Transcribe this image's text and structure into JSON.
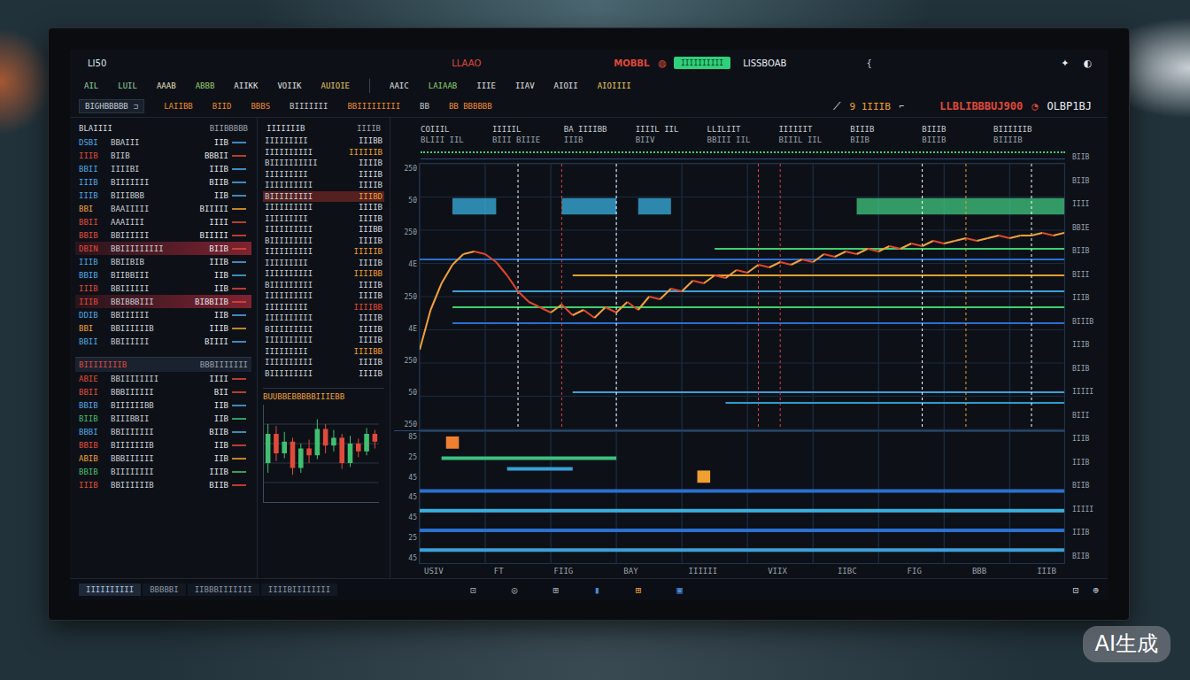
{
  "header": {
    "logo": "LI50",
    "title": "LLAAO",
    "mode": "MOBBL",
    "mode_icon": "◍",
    "action": "IIIIIIIIII",
    "account": "LISSBOAB",
    "extra": "{",
    "icons": [
      "✦",
      "◐"
    ]
  },
  "menu": {
    "left": [
      {
        "label": "AIL",
        "color": "#8fd0a0"
      },
      {
        "label": "LUIL",
        "color": "#8fd0a0"
      },
      {
        "label": "AAAB",
        "color": "#e6e0c0"
      },
      {
        "label": "ABBB",
        "color": "#9ad070"
      },
      {
        "label": "AIIKK",
        "color": "#e0e0e0"
      },
      {
        "label": "VOIIK",
        "color": "#e0e0e0"
      },
      {
        "label": "AUIOIE",
        "color": "#e8c860"
      }
    ],
    "right": [
      {
        "label": "AAIC",
        "color": "#e0e0e0"
      },
      {
        "label": "LAIAAB",
        "color": "#8fd070"
      },
      {
        "label": "IIIE",
        "color": "#e0e0e0"
      },
      {
        "label": "IIAV",
        "color": "#e0e0e0"
      },
      {
        "label": "AIOII",
        "color": "#e0e0e0"
      },
      {
        "label": "AIOIIII",
        "color": "#e8c860"
      }
    ]
  },
  "subbar": {
    "box": {
      "label": "BIGHBBBBB",
      "icon": "⊐"
    },
    "items": [
      {
        "label": "LAIIBB",
        "color": "#f08a30"
      },
      {
        "label": "BIID",
        "color": "#f08a30"
      },
      {
        "label": "BBBS",
        "color": "#f08a30"
      },
      {
        "label": "BIIIIIII",
        "color": "#c8c8d0"
      },
      {
        "label": "BBIIIIIIIII",
        "color": "#f08a30"
      },
      {
        "label": "BB",
        "color": "#c8c8d0"
      },
      {
        "label": "BB BBBBBB",
        "color": "#f08a30"
      }
    ],
    "quote": {
      "trend_icon": "⟋",
      "value": "9 1IIIB",
      "mark": "⌐",
      "price": "LLBLIBBBUJ900",
      "alert_icon": "◔",
      "symbol": "OLBP1BJ"
    }
  },
  "watchlist": {
    "title": "BLAIIII",
    "tag": "BIIBBBBB",
    "rows": [
      {
        "code": "DSBI",
        "name": "BBAIII",
        "value": "IIB",
        "color": "#4aa8e8",
        "flagged": false
      },
      {
        "code": "IIIB",
        "name": "BIIB",
        "value": "BBBII",
        "color": "#e04a3a",
        "flagged": false
      },
      {
        "code": "BBII",
        "name": "IIIIBI",
        "value": "IIIB",
        "color": "#4aa8e8",
        "flagged": false
      },
      {
        "code": "IIIB",
        "name": "BIIIIIII",
        "value": "BIIB",
        "color": "#4aa8e8",
        "flagged": false
      },
      {
        "code": "IIIB",
        "name": "BIIIBBB",
        "value": "IIB",
        "color": "#4aa8e8",
        "flagged": false
      },
      {
        "code": "BBI",
        "name": "BAAIIIII",
        "value": "BIIIII",
        "color": "#f0a030",
        "flagged": false
      },
      {
        "code": "BBII",
        "name": "AAAIIII",
        "value": "IIII",
        "color": "#e04a3a",
        "flagged": false
      },
      {
        "code": "BBIB",
        "name": "BBIIIIII",
        "value": "BIIIII",
        "color": "#e04a3a",
        "flagged": false
      },
      {
        "code": "DBIN",
        "name": "BBIIIIIIIII",
        "value": "BIIB",
        "color": "#e04a3a",
        "flagged": true
      },
      {
        "code": "IIIB",
        "name": "BBIIBIB",
        "value": "IIIB",
        "color": "#4aa8e8",
        "flagged": false
      },
      {
        "code": "BBIB",
        "name": "BIIBBIII",
        "value": "IIB",
        "color": "#4aa8e8",
        "flagged": false
      },
      {
        "code": "IIIB",
        "name": "BBIIIIII",
        "value": "IIB",
        "color": "#e04a3a",
        "flagged": false
      },
      {
        "code": "IIIB",
        "name": "BBIBBBIII",
        "value": "BIBBIIB",
        "color": "#e04a3a",
        "flagged": true
      },
      {
        "code": "DDIB",
        "name": "BBIIIIII",
        "value": "IIB",
        "color": "#4aa8e8",
        "flagged": false
      },
      {
        "code": "BBI",
        "name": "BBIIIIIIB",
        "value": "IIIB",
        "color": "#f0a030",
        "flagged": false
      },
      {
        "code": "BBII",
        "name": "BBIIIIII",
        "value": "BIIII",
        "color": "#4aa8e8",
        "flagged": false
      }
    ]
  },
  "positions": {
    "title": "BIIIIIIIIB",
    "tag": "BBBIIIIIII",
    "rows": [
      {
        "code": "ABIE",
        "name": "BBIIIIIIII",
        "value": "IIII",
        "color": "#e04a3a",
        "flagged": false
      },
      {
        "code": "BBII",
        "name": "BBBIIIIII",
        "value": "BII",
        "color": "#e04a3a",
        "flagged": false
      },
      {
        "code": "BBIB",
        "name": "BIIIIIIBB",
        "value": "IIB",
        "color": "#4aa8e8",
        "flagged": false
      },
      {
        "code": "BIIB",
        "name": "BIIIBBII",
        "value": "IIB",
        "color": "#40c070",
        "flagged": false
      },
      {
        "code": "BBBI",
        "name": "BBIIIIIII",
        "value": "BIIB",
        "color": "#4aa8e8",
        "flagged": false
      },
      {
        "code": "BBIB",
        "name": "BIIIIIIIB",
        "value": "IIB",
        "color": "#e04a3a",
        "flagged": false
      },
      {
        "code": "ABIB",
        "name": "BBBIIIIII",
        "value": "IIB",
        "color": "#f0a030",
        "flagged": false
      },
      {
        "code": "BBIB",
        "name": "BIIIIIIII",
        "value": "IIIB",
        "color": "#40c070",
        "flagged": false
      },
      {
        "code": "IIIB",
        "name": "BBIIIIIIB",
        "value": "BIIB",
        "color": "#e04a3a",
        "flagged": false
      }
    ]
  },
  "orders": {
    "title": "IIIIIIIB",
    "tag": "IIIIB",
    "rows": [
      {
        "label": "IIIIIIIII",
        "value": "IIIBB",
        "color": "#d8d8e0",
        "flagged": false
      },
      {
        "label": "IIIIIIIIII",
        "value": "IIIIIIB",
        "color": "#f0a030",
        "flagged": false
      },
      {
        "label": "BIIIIIIIIII",
        "value": "IIIIB",
        "color": "#d8d8e0",
        "flagged": false
      },
      {
        "label": "IIIIIIIII",
        "value": "IIIIB",
        "color": "#d8d8e0",
        "flagged": false
      },
      {
        "label": "IIIIIIIIII",
        "value": "IIIIB",
        "color": "#d8d8e0",
        "flagged": false
      },
      {
        "label": "BIIIIIIIII",
        "value": "IIIBD",
        "color": "#f0a030",
        "flagged": true
      },
      {
        "label": "IIIIIIIIII",
        "value": "IIIIB",
        "color": "#d8d8e0",
        "flagged": false
      },
      {
        "label": "IIIIIIIII",
        "value": "IIIIB",
        "color": "#d8d8e0",
        "flagged": false
      },
      {
        "label": "IIIIIIIIII",
        "value": "IIIBB",
        "color": "#d8d8e0",
        "flagged": false
      },
      {
        "label": "BIIIIIIIII",
        "value": "IIIIB",
        "color": "#d8d8e0",
        "flagged": false
      },
      {
        "label": "IIIIIIIIII",
        "value": "IIIIIB",
        "color": "#f0a030",
        "flagged": false
      },
      {
        "label": "IIIIIIIII",
        "value": "IIIIB",
        "color": "#d8d8e0",
        "flagged": false
      },
      {
        "label": "IIIIIIIIII",
        "value": "IIIIBB",
        "color": "#f0a030",
        "flagged": false
      },
      {
        "label": "BIIIIIIIII",
        "value": "IIIIB",
        "color": "#d8d8e0",
        "flagged": false
      },
      {
        "label": "IIIIIIIIII",
        "value": "IIIIB",
        "color": "#d8d8e0",
        "flagged": false
      },
      {
        "label": "IIIIIIIII",
        "value": "IIIIBB",
        "color": "#e04a3a",
        "flagged": false
      },
      {
        "label": "IIIIIIIIII",
        "value": "IIIIB",
        "color": "#d8d8e0",
        "flagged": false
      },
      {
        "label": "BIIIIIIIII",
        "value": "IIIIB",
        "color": "#d8d8e0",
        "flagged": false
      },
      {
        "label": "IIIIIIIIII",
        "value": "IIIIB",
        "color": "#d8d8e0",
        "flagged": false
      },
      {
        "label": "IIIIIIIII",
        "value": "IIIIBB",
        "color": "#f0a030",
        "flagged": false
      },
      {
        "label": "IIIIIIIIII",
        "value": "IIIIB",
        "color": "#d8d8e0",
        "flagged": false
      },
      {
        "label": "BIIIIIIIII",
        "value": "IIIIB",
        "color": "#d8d8e0",
        "flagged": false
      }
    ]
  },
  "candles": {
    "title": "BUUBBEBBBBBIIIEBB",
    "values": [
      {
        "open": 40,
        "close": 70,
        "high": 80,
        "low": 30
      },
      {
        "open": 70,
        "close": 50,
        "high": 78,
        "low": 42
      },
      {
        "open": 50,
        "close": 62,
        "high": 72,
        "low": 45
      },
      {
        "open": 62,
        "close": 35,
        "high": 66,
        "low": 28
      },
      {
        "open": 35,
        "close": 55,
        "high": 60,
        "low": 30
      },
      {
        "open": 55,
        "close": 48,
        "high": 64,
        "low": 40
      },
      {
        "open": 48,
        "close": 75,
        "high": 85,
        "low": 44
      },
      {
        "open": 75,
        "close": 58,
        "high": 80,
        "low": 50
      },
      {
        "open": 58,
        "close": 66,
        "high": 74,
        "low": 52
      },
      {
        "open": 66,
        "close": 40,
        "high": 70,
        "low": 34
      },
      {
        "open": 40,
        "close": 60,
        "high": 68,
        "low": 36
      },
      {
        "open": 60,
        "close": 52,
        "high": 65,
        "low": 46
      },
      {
        "open": 52,
        "close": 70,
        "high": 76,
        "low": 48
      },
      {
        "open": 70,
        "close": 62,
        "high": 74,
        "low": 55
      }
    ]
  },
  "chart": {
    "header": [
      {
        "title": "COIIIL",
        "value": "BLIII IIL"
      },
      {
        "title": "IIIIIL",
        "value": "BIII BIIIE"
      },
      {
        "title": "BA IIIIBB",
        "value": "IIIB"
      },
      {
        "title": "IIIIL IIL",
        "value": "BIIV"
      },
      {
        "title": "LLILIIT",
        "value": "BBIII IIL"
      },
      {
        "title": "IIIIIIT",
        "value": "BIIIL IIL"
      },
      {
        "title": "BIIIB",
        "value": "BIIB"
      },
      {
        "title": "BIIIB",
        "value": "BIIIB"
      },
      {
        "title": "BIIIIIIB",
        "value": "BIIIIB"
      }
    ],
    "y_ticks": [
      "250",
      "50",
      "250",
      "4E",
      "250",
      "4E",
      "250",
      "50",
      "250"
    ],
    "price": [
      30,
      45,
      55,
      62,
      66,
      67,
      66,
      63,
      58,
      52,
      48,
      46,
      44,
      47,
      43,
      45,
      42,
      46,
      44,
      48,
      45,
      50,
      49,
      53,
      52,
      56,
      55,
      58,
      57,
      60,
      59,
      62,
      61,
      63,
      62,
      64,
      63,
      66,
      65,
      67,
      66,
      68,
      67,
      69,
      68,
      70,
      69,
      71,
      70,
      71,
      72,
      71,
      72,
      73,
      72,
      73,
      73,
      74,
      73,
      74
    ],
    "bands": [
      {
        "value": 84,
        "from": 3,
        "to": 7,
        "color": "#3ab0e0"
      },
      {
        "value": 84,
        "from": 13,
        "to": 18,
        "color": "#3ab0e0"
      },
      {
        "value": 84,
        "from": 20,
        "to": 23,
        "color": "#3ab0e0"
      },
      {
        "value": 84,
        "from": 40,
        "to": 59,
        "color": "#40c880"
      }
    ],
    "levels": [
      {
        "value": 68,
        "from": 27,
        "to": 59,
        "color": "#3cd070"
      },
      {
        "value": 64,
        "from": 0,
        "to": 59,
        "color": "#2a6fd0"
      },
      {
        "value": 58,
        "from": 14,
        "to": 59,
        "color": "#e0a030"
      },
      {
        "value": 52,
        "from": 3,
        "to": 59,
        "color": "#3aa0d8"
      },
      {
        "value": 46,
        "from": 3,
        "to": 59,
        "color": "#3cd070"
      },
      {
        "value": 40,
        "from": 3,
        "to": 59,
        "color": "#2a6fd0"
      },
      {
        "value": 14,
        "from": 14,
        "to": 59,
        "color": "#3aa0d8"
      },
      {
        "value": 10,
        "from": 28,
        "to": 59,
        "color": "#2a9fd0"
      }
    ],
    "markers": [
      {
        "at": 9,
        "color": "#ffffff"
      },
      {
        "at": 13,
        "color": "#e04040"
      },
      {
        "at": 18,
        "color": "#ffffff"
      },
      {
        "at": 31,
        "color": "#e04040"
      },
      {
        "at": 33,
        "color": "#e04040"
      },
      {
        "at": 46,
        "color": "#ffffff"
      },
      {
        "at": 50,
        "color": "#f0a030"
      },
      {
        "at": 56,
        "color": "#ffffff"
      }
    ]
  },
  "lower": {
    "y_ticks": [
      "85",
      "25",
      "45",
      "45",
      "45",
      "25",
      "45"
    ],
    "bars": [
      {
        "value": 80,
        "from": 2,
        "to": 18,
        "color": "#3cc080"
      },
      {
        "value": 72,
        "from": 8,
        "to": 14,
        "color": "#3aa0d8"
      },
      {
        "value": 55,
        "from": 0,
        "to": 59,
        "color": "#2a70d0"
      },
      {
        "value": 40,
        "from": 0,
        "to": 59,
        "color": "#3ab0e0"
      },
      {
        "value": 25,
        "from": 0,
        "to": 59,
        "color": "#2a70d0"
      },
      {
        "value": 10,
        "from": 0,
        "to": 59,
        "color": "#3aa0d8"
      }
    ],
    "points": [
      {
        "at": 3,
        "value": 92,
        "color": "#f08030"
      },
      {
        "at": 26,
        "value": 66,
        "color": "#f0a030"
      }
    ]
  },
  "x_ticks": [
    "USIV",
    "FT",
    "FIIG",
    "BAY",
    "IIIIII",
    "VIIX",
    "IIBC",
    "FIG",
    "BBB",
    "IIIB"
  ],
  "right_axis": [
    "BIIB",
    "BIIB",
    "IIII",
    "BBIE",
    "BIIB",
    "BIII",
    "IIIB",
    "BIIIB",
    "IIIB",
    "BIIB",
    "IIIII",
    "BIII",
    "IIIB",
    "IIIB",
    "BIIB",
    "IIIII",
    "IIIB",
    "BIIB"
  ],
  "status_bar": {
    "tabs": [
      {
        "label": "IIIIIIIIII",
        "selected": true
      },
      {
        "label": "BBBBBI",
        "selected": false
      },
      {
        "label": "IIBBBIIIIIII",
        "selected": false
      },
      {
        "label": "IIIIBIIIIIIII",
        "selected": false
      }
    ],
    "icons": [
      {
        "glyph": "⊡",
        "color": "#a8b0b8"
      },
      {
        "glyph": "◎",
        "color": "#a8b0b8"
      },
      {
        "glyph": "⊞",
        "color": "#a8b0b8"
      },
      {
        "glyph": "▮",
        "color": "#4a8ad8"
      },
      {
        "glyph": "⊞",
        "color": "#f0a030"
      },
      {
        "glyph": "▣",
        "color": "#4a8ad8"
      }
    ],
    "end_icons": [
      "⊡",
      "⊕"
    ]
  },
  "watermark": "AI生成"
}
